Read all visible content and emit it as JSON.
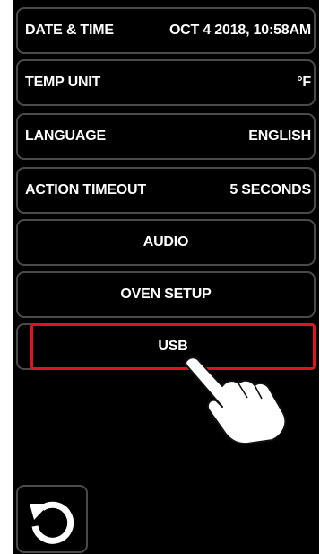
{
  "settings": {
    "date_time": {
      "label": "DATE & TIME",
      "value": "OCT 4 2018, 10:58AM"
    },
    "temp_unit": {
      "label": "TEMP UNIT",
      "value": "°F"
    },
    "language": {
      "label": "LANGUAGE",
      "value": "ENGLISH"
    },
    "action_timeout": {
      "label": "ACTION TIMEOUT",
      "value": "5 SECONDS"
    },
    "audio": {
      "label": "AUDIO"
    },
    "oven_setup": {
      "label": "OVEN SETUP"
    },
    "usb": {
      "label": "USB"
    }
  },
  "icons": {
    "back": "back-arrow-icon",
    "pointer": "pointing-hand-icon"
  },
  "colors": {
    "background": "#000000",
    "text": "#ffffff",
    "row_border": "#4a4a4a",
    "highlight_border": "#e0141e"
  }
}
